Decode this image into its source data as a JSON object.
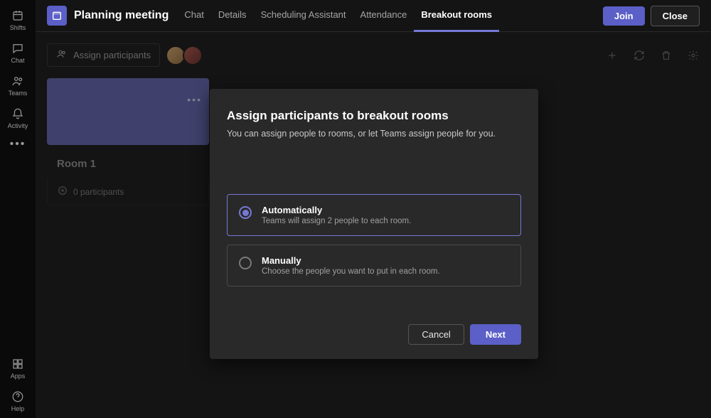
{
  "rail": {
    "items": [
      {
        "label": "Shifts"
      },
      {
        "label": "Chat"
      },
      {
        "label": "Teams"
      },
      {
        "label": "Activity"
      }
    ],
    "bottom": [
      {
        "label": "Apps"
      },
      {
        "label": "Help"
      }
    ]
  },
  "header": {
    "title": "Planning meeting",
    "tabs": [
      {
        "label": "Chat"
      },
      {
        "label": "Details"
      },
      {
        "label": "Scheduling Assistant"
      },
      {
        "label": "Attendance"
      },
      {
        "label": "Breakout rooms"
      }
    ],
    "join_label": "Join",
    "close_label": "Close"
  },
  "toolbar": {
    "assign_label": "Assign participants"
  },
  "room": {
    "title": "Room 1",
    "participants_text": "0 participants"
  },
  "modal": {
    "title": "Assign participants to breakout rooms",
    "subtitle": "You can assign people to rooms, or let Teams assign people for you.",
    "options": [
      {
        "title": "Automatically",
        "desc": "Teams will assign 2 people to each room."
      },
      {
        "title": "Manually",
        "desc": "Choose the people you want to put in each room."
      }
    ],
    "cancel_label": "Cancel",
    "next_label": "Next"
  }
}
